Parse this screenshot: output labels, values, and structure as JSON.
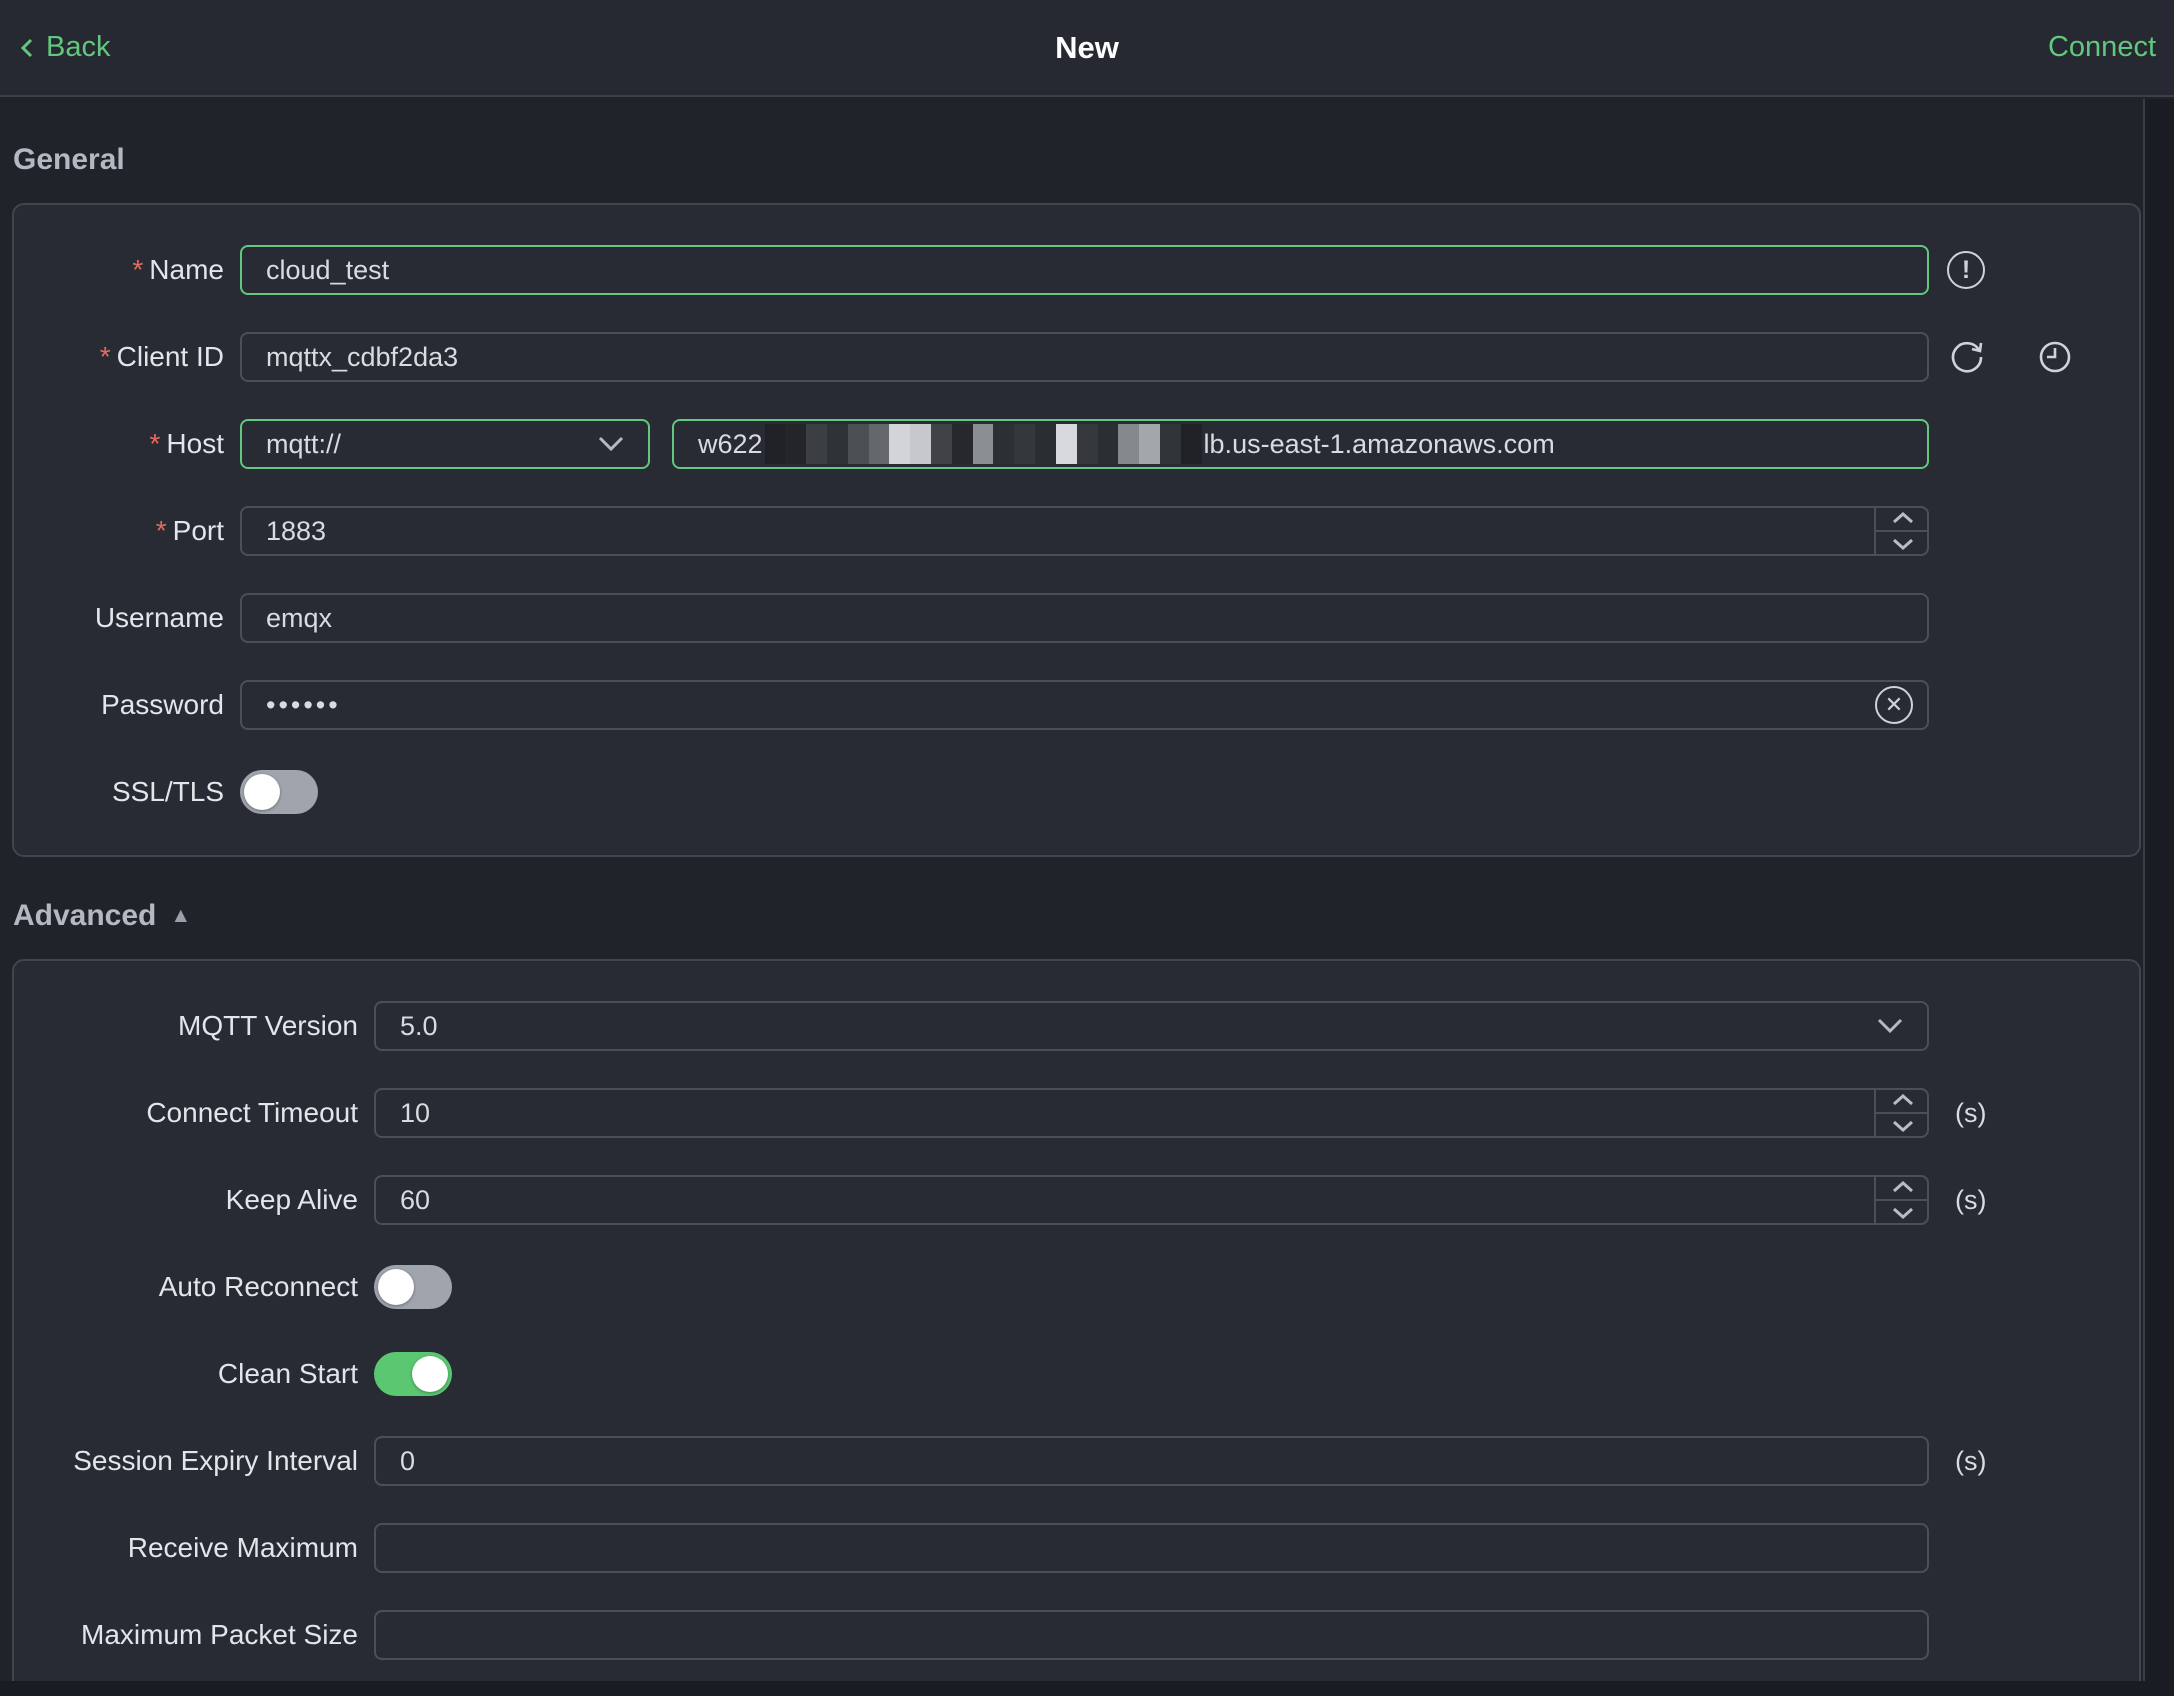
{
  "topbar": {
    "back_label": "Back",
    "title": "New",
    "connect_label": "Connect"
  },
  "marks": {
    "required": "*"
  },
  "sections": {
    "general_title": "General",
    "advanced_title": "Advanced",
    "advanced_collapse_icon": "▲"
  },
  "general": {
    "name": {
      "label": "Name",
      "value": "cloud_test"
    },
    "client_id": {
      "label": "Client ID",
      "value": "mqttx_cdbf2da3"
    },
    "host": {
      "label": "Host",
      "protocol": "mqtt://",
      "value_prefix": "w622",
      "value_suffix": "lb.us-east-1.amazonaws.com",
      "blur_blocks": [
        "#1f2126",
        "#232529",
        "#3b3e43",
        "#2f3237",
        "#4b4e53",
        "#64676c",
        "#d2d4d9",
        "#c6c8cd",
        "#3f4247",
        "#26282d",
        "#8b8e93",
        "#2c2f34",
        "#34373c",
        "#2a2d32",
        "#d7d9de",
        "#35383d",
        "#2b2e33",
        "#85888d",
        "#a3a6ab",
        "#303338",
        "#202227"
      ]
    },
    "port": {
      "label": "Port",
      "value": "1883"
    },
    "username": {
      "label": "Username",
      "value": "emqx"
    },
    "password": {
      "label": "Password",
      "value": "••••••"
    },
    "ssl": {
      "label": "SSL/TLS",
      "enabled": false
    }
  },
  "advanced": {
    "mqtt_version": {
      "label": "MQTT Version",
      "value": "5.0"
    },
    "connect_timeout": {
      "label": "Connect Timeout",
      "value": "10",
      "unit": "(s)"
    },
    "keep_alive": {
      "label": "Keep Alive",
      "value": "60",
      "unit": "(s)"
    },
    "auto_reconnect": {
      "label": "Auto Reconnect",
      "enabled": false
    },
    "clean_start": {
      "label": "Clean Start",
      "enabled": true
    },
    "session_expiry": {
      "label": "Session Expiry Interval",
      "value": "0",
      "unit": "(s)"
    },
    "receive_maximum": {
      "label": "Receive Maximum",
      "value": ""
    },
    "max_packet_size": {
      "label": "Maximum Packet Size",
      "value": ""
    }
  },
  "colors": {
    "accent_green": "#63c77d",
    "danger_red": "#e56c5c",
    "toggle_on": "#5bc871"
  }
}
